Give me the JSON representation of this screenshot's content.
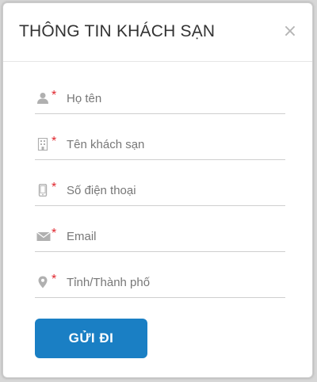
{
  "modal": {
    "title": "THÔNG TIN KHÁCH SẠN",
    "close_label": "×"
  },
  "form": {
    "required_marker": "*",
    "fields": [
      {
        "name": "full-name",
        "icon": "user-icon",
        "placeholder": "Họ tên"
      },
      {
        "name": "hotel-name",
        "icon": "building-icon",
        "placeholder": "Tên khách sạn"
      },
      {
        "name": "phone",
        "icon": "mobile-phone-icon",
        "placeholder": "Số điện thoại"
      },
      {
        "name": "email",
        "icon": "envelope-icon",
        "placeholder": "Email"
      },
      {
        "name": "city",
        "icon": "map-marker-icon",
        "placeholder": "Tỉnh/Thành phố"
      }
    ],
    "submit_label": "GỬI ĐI"
  },
  "colors": {
    "accent": "#1a7fc4",
    "required": "#e0262e",
    "icon": "#b0b0b0"
  }
}
